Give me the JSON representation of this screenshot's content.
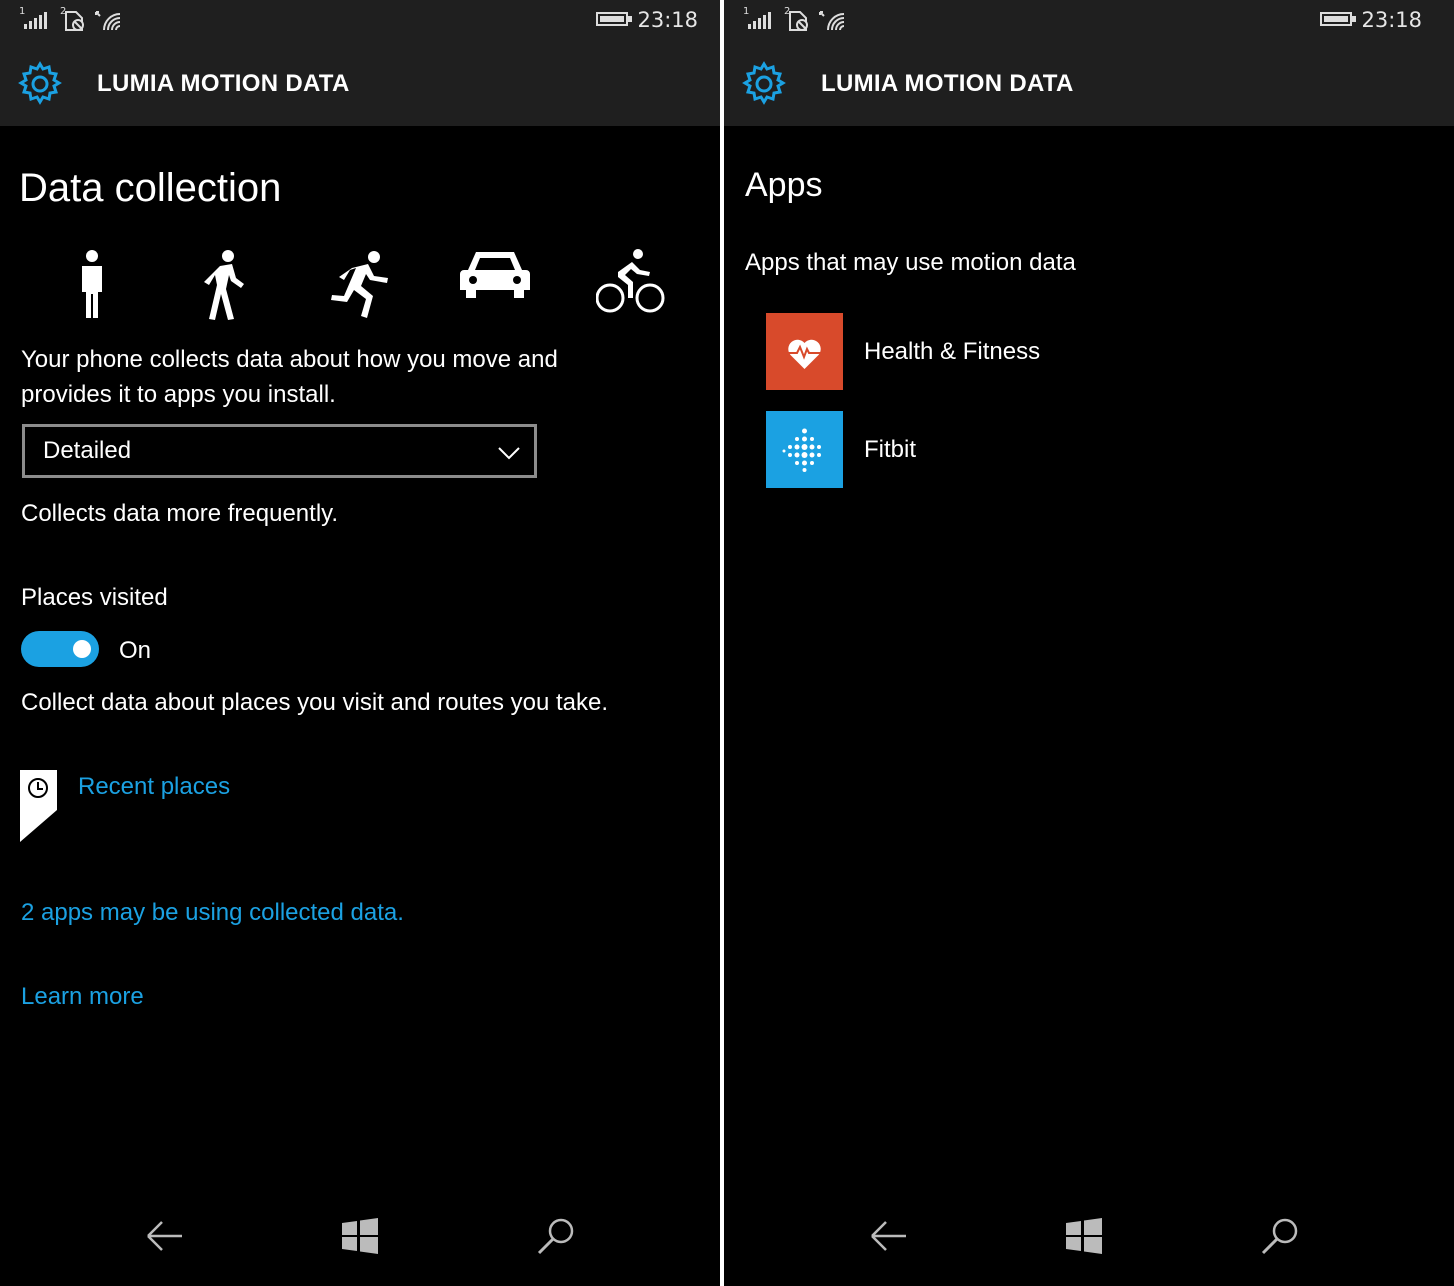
{
  "status_bar": {
    "sim1": "1",
    "sim2": "2",
    "time": "23:18"
  },
  "app": {
    "title": "LUMIA MOTION DATA"
  },
  "left": {
    "heading": "Data collection",
    "motion_icons": [
      "standing-icon",
      "walking-icon",
      "running-icon",
      "car-icon",
      "cycling-icon"
    ],
    "description_line1": "Your phone collects data about how you move and",
    "description_line2": "provides it to apps you install.",
    "dropdown": {
      "value": "Detailed"
    },
    "dropdown_help": "Collects data more frequently.",
    "places_label": "Places visited",
    "toggle": {
      "state": "On",
      "on": true
    },
    "places_help": "Collect data about places you visit and routes you take.",
    "recent_places": "Recent places",
    "apps_link": "2 apps may be using collected data.",
    "learn_more": "Learn more"
  },
  "right": {
    "heading": "Apps",
    "subheading": "Apps that may use motion data",
    "apps": [
      {
        "name": "Health & Fitness",
        "tile_color": "#d84a2b",
        "icon": "heart-pulse-icon"
      },
      {
        "name": "Fitbit",
        "tile_color": "#1ba1e2",
        "icon": "fitbit-logo-icon"
      }
    ]
  },
  "colors": {
    "accent": "#1ba1e2",
    "background": "#000000",
    "header": "#1f1f1f"
  }
}
